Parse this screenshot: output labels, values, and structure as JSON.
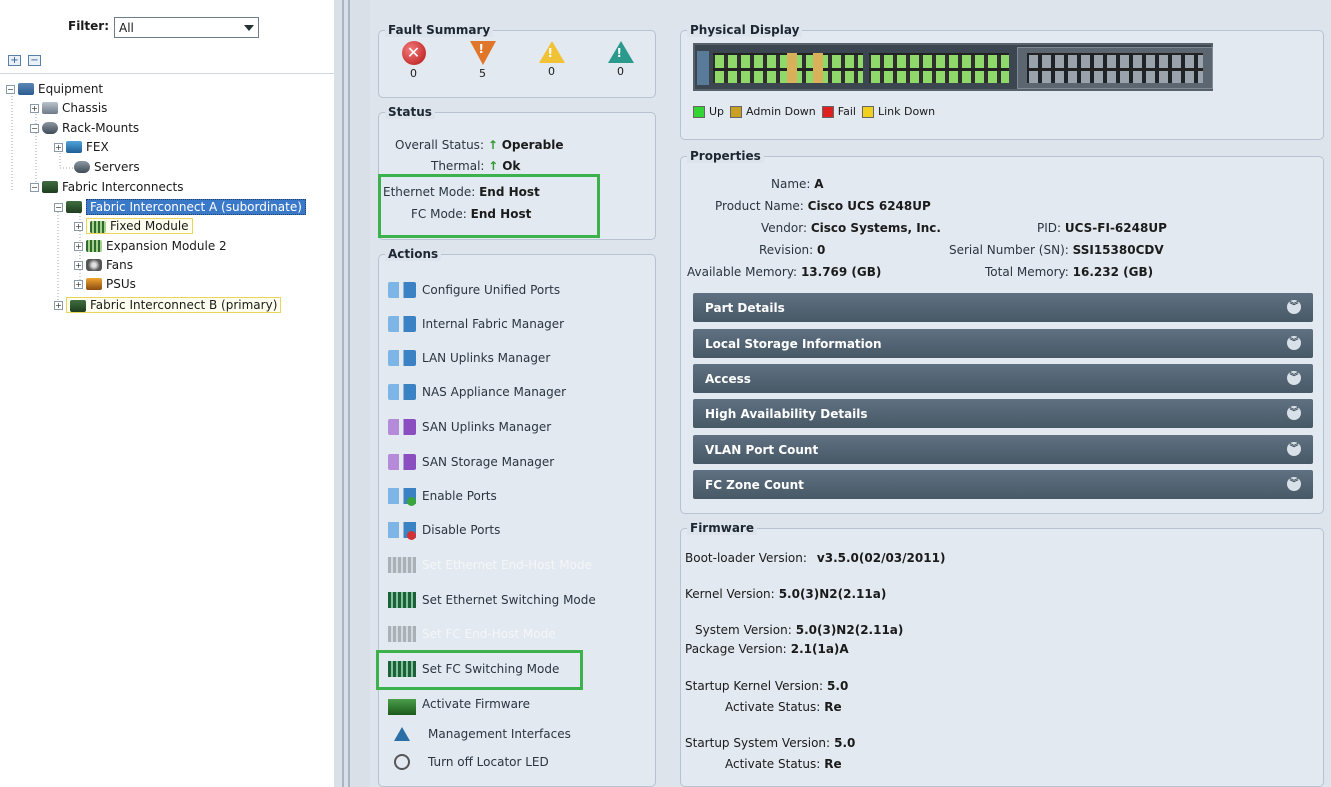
{
  "nav": {
    "filter_label": "Filter:",
    "filter_value": "All",
    "expand_label": "+",
    "collapse_label": "−",
    "tree": {
      "equipment": "Equipment",
      "chassis": "Chassis",
      "rack_mounts": "Rack-Mounts",
      "fex": "FEX",
      "servers": "Servers",
      "fabric_interconnects": "Fabric Interconnects",
      "fi_a": "Fabric Interconnect A (subordinate)",
      "fixed_module": "Fixed Module",
      "expansion_module": "Expansion Module 2",
      "fans": "Fans",
      "psus": "PSUs",
      "fi_b": "Fabric Interconnect B (primary)"
    }
  },
  "fault_summary": {
    "title": "Fault Summary",
    "critical": "0",
    "major": "5",
    "minor": "0",
    "warning": "0"
  },
  "status": {
    "title": "Status",
    "overall_label": "Overall Status:",
    "overall_value": "Operable",
    "thermal_label": "Thermal:",
    "thermal_value": "Ok",
    "ethernet_label": "Ethernet Mode:",
    "ethernet_value": "End Host",
    "fc_label": "FC Mode:",
    "fc_value": "End Host"
  },
  "actions": {
    "title": "Actions",
    "items": [
      "Configure Unified Ports",
      "Internal Fabric Manager",
      "LAN Uplinks Manager",
      "NAS Appliance Manager",
      "SAN Uplinks Manager",
      "SAN Storage Manager",
      "Enable Ports",
      "Disable Ports",
      "Set Ethernet End-Host Mode",
      "Set Ethernet Switching Mode",
      "Set FC End-Host Mode",
      "Set FC Switching Mode",
      "Activate Firmware",
      "Management Interfaces",
      "Turn off Locator LED"
    ]
  },
  "physical_display": {
    "title": "Physical Display",
    "legend": [
      "Up",
      "Admin Down",
      "Fail",
      "Link Down"
    ],
    "colors": {
      "up": "#35d435",
      "admin_down": "#c9a020",
      "fail": "#e02020",
      "link_down": "#f2d020"
    }
  },
  "properties": {
    "title": "Properties",
    "name_label": "Name:",
    "name_value": "A",
    "product_label": "Product Name:",
    "product_value": "Cisco UCS 6248UP",
    "vendor_label": "Vendor:",
    "vendor_value": "Cisco Systems, Inc.",
    "pid_label": "PID:",
    "pid_value": "UCS-FI-6248UP",
    "revision_label": "Revision:",
    "revision_value": "0",
    "serial_label": "Serial Number (SN):",
    "serial_value": "SSI15380CDV",
    "avail_mem_label": "Available Memory:",
    "avail_mem_value": "13.769 (GB)",
    "total_mem_label": "Total Memory:",
    "total_mem_value": "16.232 (GB)",
    "sections": [
      "Part Details",
      "Local Storage Information",
      "Access",
      "High Availability Details",
      "VLAN Port Count",
      "FC Zone Count"
    ]
  },
  "firmware": {
    "title": "Firmware",
    "boot_label": "Boot-loader Version:",
    "boot_value": "v3.5.0(02/03/2011)",
    "kernel_label": "Kernel Version:",
    "kernel_value": "5.0(3)N2(2.11a)",
    "system_label": "System Version:",
    "system_value": "5.0(3)N2(2.11a)",
    "package_label": "Package Version:",
    "package_value": "2.1(1a)A",
    "startup_kernel_label": "Startup Kernel Version:",
    "startup_kernel_value": "5.0",
    "activate_status_label": "Activate Status:",
    "activate_status_value": "Re",
    "startup_system_label": "Startup System Version:",
    "startup_system_value": "5.0",
    "activate_status2_label": "Activate Status:",
    "activate_status2_value": "Re"
  }
}
